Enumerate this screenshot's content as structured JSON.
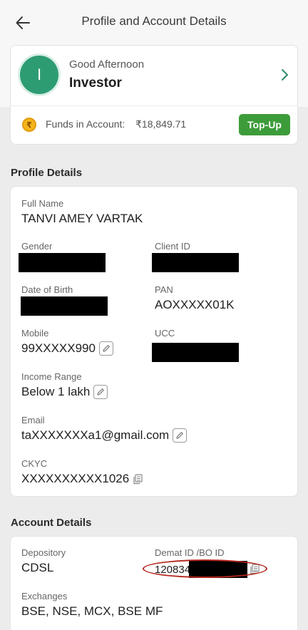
{
  "header": {
    "back_icon": "arrow-left-icon",
    "title": "Profile and Account Details"
  },
  "greeting": {
    "avatar_letter": "I",
    "salutation": "Good Afternoon",
    "name": "Investor",
    "chevron_icon": "chevron-right-icon"
  },
  "funds": {
    "icon": "rupee-coin-icon",
    "coin_glyph": "₹",
    "label": "Funds in Account:",
    "value": "₹18,849.71",
    "topup_label": "Top-Up",
    "topup_color": "#3d9c3a"
  },
  "profile": {
    "section_title": "Profile Details",
    "full_name_label": "Full Name",
    "full_name": "TANVI AMEY VARTAK",
    "gender_label": "Gender",
    "client_id_label": "Client ID",
    "dob_label": "Date of Birth",
    "pan_label": "PAN",
    "pan": "AOXXXXX01K",
    "mobile_label": "Mobile",
    "mobile": "99XXXXX990",
    "ucc_label": "UCC",
    "income_label": "Income Range",
    "income": "Below 1 lakh",
    "email_label": "Email",
    "email": "taXXXXXXXa1@gmail.com",
    "ckyc_label": "CKYC",
    "ckyc": "XXXXXXXXXX1026"
  },
  "account": {
    "section_title": "Account Details",
    "depository_label": "Depository",
    "depository": "CDSL",
    "demat_label": "Demat ID /BO ID",
    "demat_prefix": "120834",
    "exchanges_label": "Exchanges",
    "exchanges": "BSE, NSE, MCX, BSE MF"
  },
  "colors": {
    "brand_green": "#2e9c73",
    "annotation_red": "#b3261e",
    "redaction": "#000000"
  }
}
